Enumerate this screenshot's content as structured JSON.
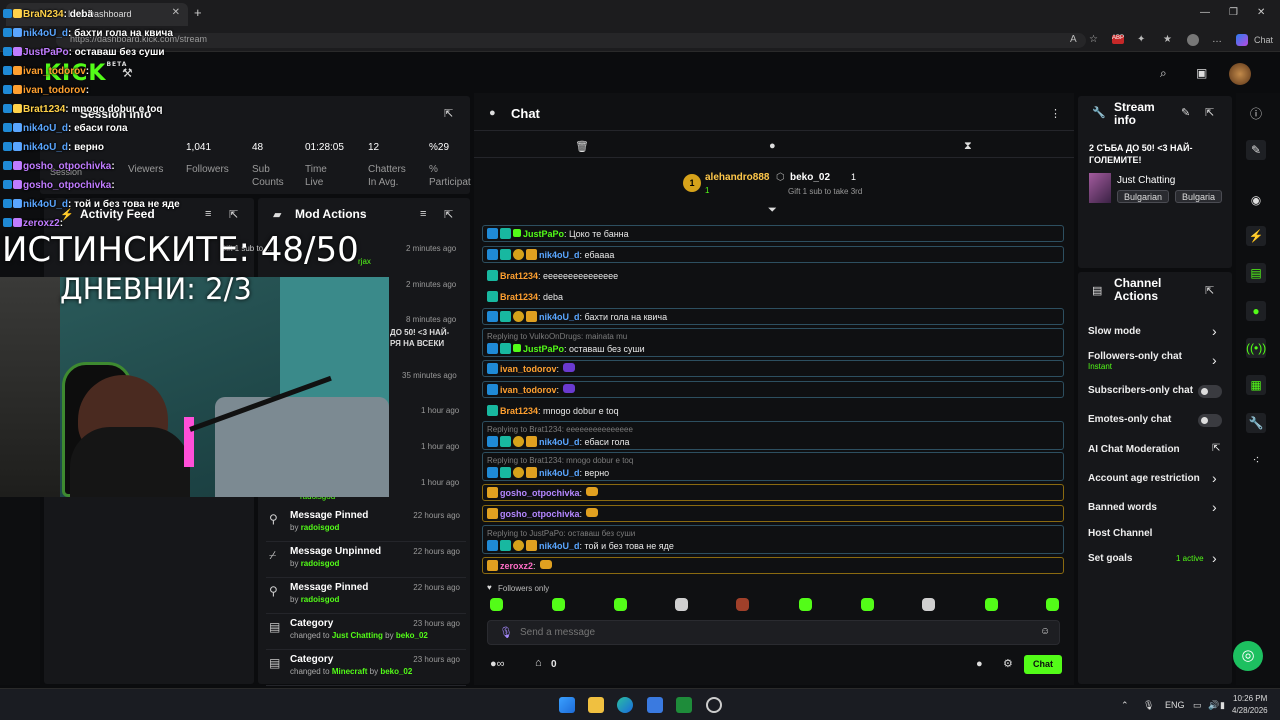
{
  "browser": {
    "tab_title": "Kick Dashboard",
    "url": "https://dashboard.kick.com/stream",
    "chat_label": "Chat"
  },
  "site": {
    "logo": "KICK",
    "logo_badge": "BETA"
  },
  "session": {
    "title": "Session info",
    "stats": [
      {
        "value": "",
        "label": "Viewers"
      },
      {
        "value": "1,041",
        "label": "Followers"
      },
      {
        "value": "48",
        "label": "Sub Counts"
      },
      {
        "value": "01:28:05",
        "label": "Time Live"
      },
      {
        "value": "12",
        "label": "Chatters In Avg."
      },
      {
        "value": "%29",
        "label": "% Participat"
      }
    ],
    "session_label": "Session"
  },
  "activity_feed": {
    "title": "Activity Feed",
    "times": [
      "2 minutes ago",
      "2 minutes ago",
      "8 minutes ago",
      "35 minutes ago",
      "1 hour ago",
      "1 hour ago",
      "1 hour ago"
    ],
    "snippets": [
      "Gift 1 sub to ...",
      "rjax",
      "ДО 50! <3 НАЙ-",
      "РЯ НА ВСЕКИ",
      "radoisgod"
    ]
  },
  "mod_actions": {
    "title": "Mod Actions",
    "items": [
      {
        "title": "Message Pinned",
        "pre": "by",
        "user": "radoisgod",
        "mid": "",
        "target": "",
        "by": "",
        "by_user": "",
        "time": "22 hours ago",
        "icon": "pin-icon"
      },
      {
        "title": "Message Unpinned",
        "pre": "by",
        "user": "radoisgod",
        "mid": "",
        "target": "",
        "by": "",
        "by_user": "",
        "time": "22 hours ago",
        "icon": "unpin-icon"
      },
      {
        "title": "Message Pinned",
        "pre": "by",
        "user": "radoisgod",
        "mid": "",
        "target": "",
        "by": "",
        "by_user": "",
        "time": "22 hours ago",
        "icon": "pin-icon"
      },
      {
        "title": "Category",
        "pre": "changed to",
        "user": "",
        "mid": "",
        "target": "Just Chatting",
        "by": "by",
        "by_user": "beko_02",
        "time": "23 hours ago",
        "icon": "category-icon"
      },
      {
        "title": "Category",
        "pre": "changed to",
        "user": "",
        "mid": "",
        "target": "Minecraft",
        "by": "by",
        "by_user": "beko_02",
        "time": "23 hours ago",
        "icon": "category-icon"
      }
    ]
  },
  "chat": {
    "title": "Chat",
    "top_gifters": [
      {
        "name": "alehandro888",
        "count": "1",
        "rank": "1"
      },
      {
        "name": "beko_02",
        "count": "1",
        "note": "Gift 1 sub to take 3rd"
      }
    ],
    "messages": [
      {
        "reply": "",
        "user": "JustPaPo",
        "color": "n-green",
        "text": ": Цоко те банна",
        "style": "blue",
        "badges": [
          "bl",
          "tl",
          "gr"
        ]
      },
      {
        "reply": "",
        "user": "nik4oU_d",
        "color": "n-blue",
        "text": ": ебаааа",
        "style": "blue",
        "badges": [
          "bl",
          "tl",
          "go",
          "cr"
        ]
      },
      {
        "reply": "",
        "user": "Brat1234",
        "color": "n-orange",
        "text": ": еееееееееееееее",
        "style": "plain",
        "badges": [
          "tl"
        ]
      },
      {
        "reply": "",
        "user": "Brat1234",
        "color": "n-orange",
        "text": ": deba",
        "style": "plain",
        "badges": [
          "tl"
        ]
      },
      {
        "reply": "",
        "user": "nik4oU_d",
        "color": "n-blue",
        "text": ": бахти гола на квича",
        "style": "blue",
        "badges": [
          "bl",
          "tl",
          "go",
          "cr"
        ]
      },
      {
        "reply": "Replying to VulkoOnDrugs: mainata mu",
        "user": "JustPaPo",
        "color": "n-green",
        "text": ": оставаш без суши",
        "style": "blue",
        "badges": [
          "bl",
          "tl",
          "gr"
        ]
      },
      {
        "reply": "",
        "user": "ivan_todorov",
        "color": "n-orange",
        "text": ":",
        "style": "blue",
        "badges": [
          "bl"
        ]
      },
      {
        "reply": "",
        "user": "ivan_todorov",
        "color": "n-orange",
        "text": ":",
        "style": "blue",
        "badges": [
          "bl"
        ]
      },
      {
        "reply": "",
        "user": "Brat1234",
        "color": "n-orange",
        "text": ": mnogo dobur e toq",
        "style": "plain",
        "badges": [
          "tl"
        ]
      },
      {
        "reply": "Replying to Brat1234: еееееееееееееее",
        "user": "nik4oU_d",
        "color": "n-blue",
        "text": ": ебаси гола",
        "style": "blue",
        "badges": [
          "bl",
          "tl",
          "go",
          "cr"
        ]
      },
      {
        "reply": "Replying to Brat1234: mnogo dobur e toq",
        "user": "nik4oU_d",
        "color": "n-blue",
        "text": ": верно",
        "style": "blue",
        "badges": [
          "bl",
          "tl",
          "go",
          "cr"
        ]
      },
      {
        "reply": "",
        "user": "gosho_otpochivka",
        "color": "n-violet",
        "text": ":",
        "style": "gold",
        "badges": [
          "cr"
        ]
      },
      {
        "reply": "",
        "user": "gosho_otpochivka",
        "color": "n-violet",
        "text": ":",
        "style": "gold",
        "badges": [
          "cr"
        ]
      },
      {
        "reply": "Replying to JustPaPo: оставаш без суши",
        "user": "nik4oU_d",
        "color": "n-blue",
        "text": ": той и без това не яде",
        "style": "blue",
        "badges": [
          "bl",
          "tl",
          "go",
          "cr"
        ]
      },
      {
        "reply": "",
        "user": "zeroxz2",
        "color": "n-pink",
        "text": ":",
        "style": "gold",
        "badges": [
          "cr"
        ]
      }
    ],
    "followers_only": "Followers only",
    "input_placeholder": "Send a message",
    "points": "0",
    "send_label": "Chat"
  },
  "stream_info": {
    "title": "Stream info",
    "stream_title": "2 СЪБА ДО 50! <3 НАЙ-ГОЛЕМИТЕ!",
    "category": "Just Chatting",
    "tags": [
      "Bulgarian",
      "Bulgaria"
    ]
  },
  "channel_actions": {
    "title": "Channel Actions",
    "items": [
      {
        "label": "Slow mode",
        "control": "chevron"
      },
      {
        "label": "Followers-only chat",
        "sub": "Instant",
        "control": "chevron"
      },
      {
        "label": "Subscribers-only chat",
        "control": "toggle"
      },
      {
        "label": "Emotes-only chat",
        "control": "toggle"
      },
      {
        "label": "AI Chat Moderation",
        "control": "external"
      },
      {
        "label": "Account age restriction",
        "control": "chevron"
      },
      {
        "label": "Banned words",
        "control": "chevron"
      },
      {
        "label": "Host Channel",
        "control": "none"
      },
      {
        "label": "Set goals",
        "sub": "1 active",
        "control": "chevron"
      }
    ]
  },
  "overlay": {
    "chat_lines": [
      {
        "user": "BraN234",
        "text": ": debä",
        "color": "#ffd24a"
      },
      {
        "user": "nik4oU_d",
        "text": ": бахти гола на квича",
        "color": "#5aa6ff"
      },
      {
        "user": "JustPaPo",
        "text": ": оставаш без суши",
        "color": "#c07cff"
      },
      {
        "user": "ivan_todorov",
        "text": ":",
        "color": "#ffa030"
      },
      {
        "user": "ivan_todorov",
        "text": ":",
        "color": "#ffa030"
      },
      {
        "user": "Brat1234",
        "text": ": mnogo dobur e toq",
        "color": "#ffd24a"
      },
      {
        "user": "nik4oU_d",
        "text": ": ебаси гола",
        "color": "#5aa6ff"
      },
      {
        "user": "nik4oU_d",
        "text": ": верно",
        "color": "#5aa6ff"
      },
      {
        "user": "gosho_otpochivka",
        "text": ":",
        "color": "#c07cff"
      },
      {
        "user": "gosho_otpochivka",
        "text": ":",
        "color": "#c07cff"
      },
      {
        "user": "nik4oU_d",
        "text": ": той и без това не яде",
        "color": "#5aa6ff"
      },
      {
        "user": "zeroxz2",
        "text": ":",
        "color": "#c07cff"
      }
    ],
    "goal_main": "ИСТИНСКИТЕ: 48/50",
    "goal_daily": "ДНЕВНИ: 2/3"
  },
  "taskbar": {
    "lang": "ENG",
    "time": "10:26 PM",
    "date": "4/28/2026"
  },
  "colors": {
    "accent": "#53fc18",
    "panel": "#16171a"
  }
}
